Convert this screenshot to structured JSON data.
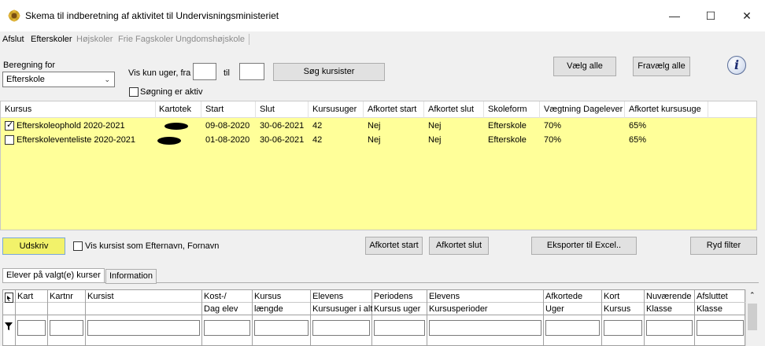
{
  "window": {
    "title": "Skema til indberetning af aktivitet til Undervisningsministeriet",
    "icon": "app-flower-icon",
    "controls": [
      "—",
      "☐",
      "✕"
    ]
  },
  "menu": [
    {
      "label": "Afslut",
      "enabled": true
    },
    {
      "label": "Efterskoler",
      "enabled": true
    },
    {
      "label": "Højskoler",
      "enabled": false
    },
    {
      "label": "Frie Fagskoler",
      "enabled": false
    },
    {
      "label": "Ungdomshøjskole",
      "enabled": false
    }
  ],
  "filter": {
    "beregning_label": "Beregning for",
    "beregning_value": "Efterskole",
    "vis_uger_label": "Vis kun uger, fra",
    "fra_value": "",
    "til_label": "til",
    "til_value": "",
    "search_button": "Søg kursister",
    "search_active_label": "Søgning er aktiv",
    "select_all": "Vælg alle",
    "deselect_all": "Fravælg alle"
  },
  "course_table": {
    "headers": [
      "Kursus",
      "Kartotek",
      "Start",
      "Slut",
      "Kursusuger",
      "Afkortet start",
      "Afkortet slut",
      "Skoleform",
      "Vægtning Dagelever",
      "Afkortet kursusuge"
    ],
    "rows": [
      {
        "checked": true,
        "kursus": "Efterskoleophold 2020-2021",
        "start": "09-08-2020",
        "slut": "30-06-2021",
        "kursusuger": "42",
        "afkortet_start": "Nej",
        "afkortet_slut": "Nej",
        "skoleform": "Efterskole",
        "vaegtning": "70%",
        "afkortet_kursusuge": "65%"
      },
      {
        "checked": false,
        "kursus": "Efterskoleventeliste 2020-2021",
        "start": "01-08-2020",
        "slut": "30-06-2021",
        "kursusuger": "42",
        "afkortet_start": "Nej",
        "afkortet_slut": "Nej",
        "skoleform": "Efterskole",
        "vaegtning": "70%",
        "afkortet_kursusuge": "65%"
      }
    ]
  },
  "actions": {
    "print": "Udskriv",
    "name_order_label": "Vis kursist som Efternavn, Fornavn",
    "afkortet_start": "Afkortet start",
    "afkortet_slut": "Afkortet slut",
    "export": "Eksporter til Excel..",
    "clear_filter": "Ryd filter"
  },
  "tabs": [
    "Elever på valgt(e) kurser",
    "Information"
  ],
  "student_table": {
    "headers_row1": [
      "Kart",
      "Kartnr",
      "Kursist",
      "Kost-/",
      "Kursus",
      "Elevens",
      "Periodens",
      "Elevens",
      "Afkortede",
      "Kort",
      "Nuværende",
      "Afsluttet"
    ],
    "headers_row2": [
      "",
      "",
      "",
      "Dag elev",
      "længde",
      "Kursusuger i alt",
      "Kursus uger",
      "Kursusperioder",
      "Uger",
      "Kursus",
      "Klasse",
      "Klasse"
    ]
  },
  "colors": {
    "grid_background": "#ffff99",
    "print_button": "#f2f26a"
  }
}
